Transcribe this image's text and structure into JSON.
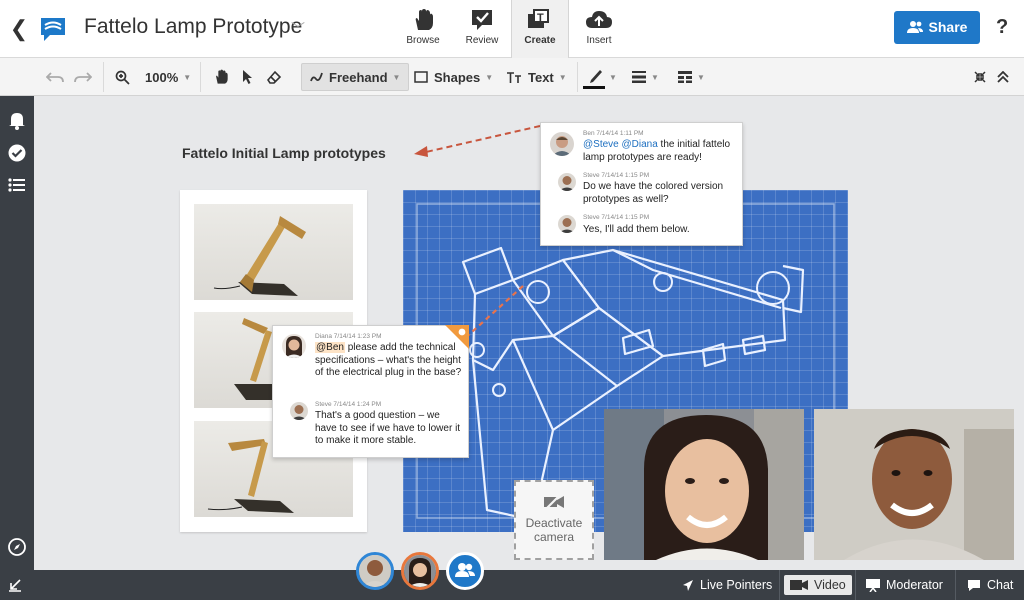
{
  "header": {
    "back": "❮",
    "title": "Fattelo Lamp Prototype",
    "modes": [
      {
        "label": "Browse",
        "icon": "hand-icon"
      },
      {
        "label": "Review",
        "icon": "review-icon"
      },
      {
        "label": "Create",
        "icon": "create-icon"
      },
      {
        "label": "Insert",
        "icon": "upload-cloud-icon"
      }
    ],
    "share_label": "Share",
    "help": "?"
  },
  "toolbar": {
    "zoom": "100%",
    "freehand": "Freehand",
    "shapes": "Shapes",
    "text": "Text"
  },
  "canvas": {
    "title": "Fattelo Initial Lamp prototypes"
  },
  "comments_top": [
    {
      "author": "Ben",
      "meta": "Ben 7/14/14 1:11 PM",
      "mentions": "@Steve @Diana",
      "text": " the initial fattelo lamp prototypes are ready!"
    },
    {
      "author": "Steve",
      "meta": "Steve 7/14/14 1:15 PM",
      "text": "Do we have the colored version prototypes as well?"
    },
    {
      "author": "Steve",
      "meta": "Steve 7/14/14 1:15 PM",
      "text": "Yes, I'll add them below."
    }
  ],
  "comments_left": [
    {
      "author": "Diana",
      "meta": "Diana 7/14/14 1:23 PM",
      "mention": "@Ben",
      "text": " please add the technical specifications – what's the height of the electrical plug in the base?"
    },
    {
      "author": "Steve",
      "meta": "Steve 7/14/14 1:24 PM",
      "text": "That's a good question – we have to see if we have to lower it to make it more stable."
    }
  ],
  "camera": {
    "line1": "Deactivate",
    "line2": "camera"
  },
  "bottom": {
    "live_pointers": "Live Pointers",
    "video": "Video",
    "moderator": "Moderator",
    "chat": "Chat"
  },
  "colors": {
    "accent": "#1f78c8",
    "blueprint": "#3c6fc3",
    "sidebar": "#3a3f45",
    "arrow": "#c8553d"
  }
}
